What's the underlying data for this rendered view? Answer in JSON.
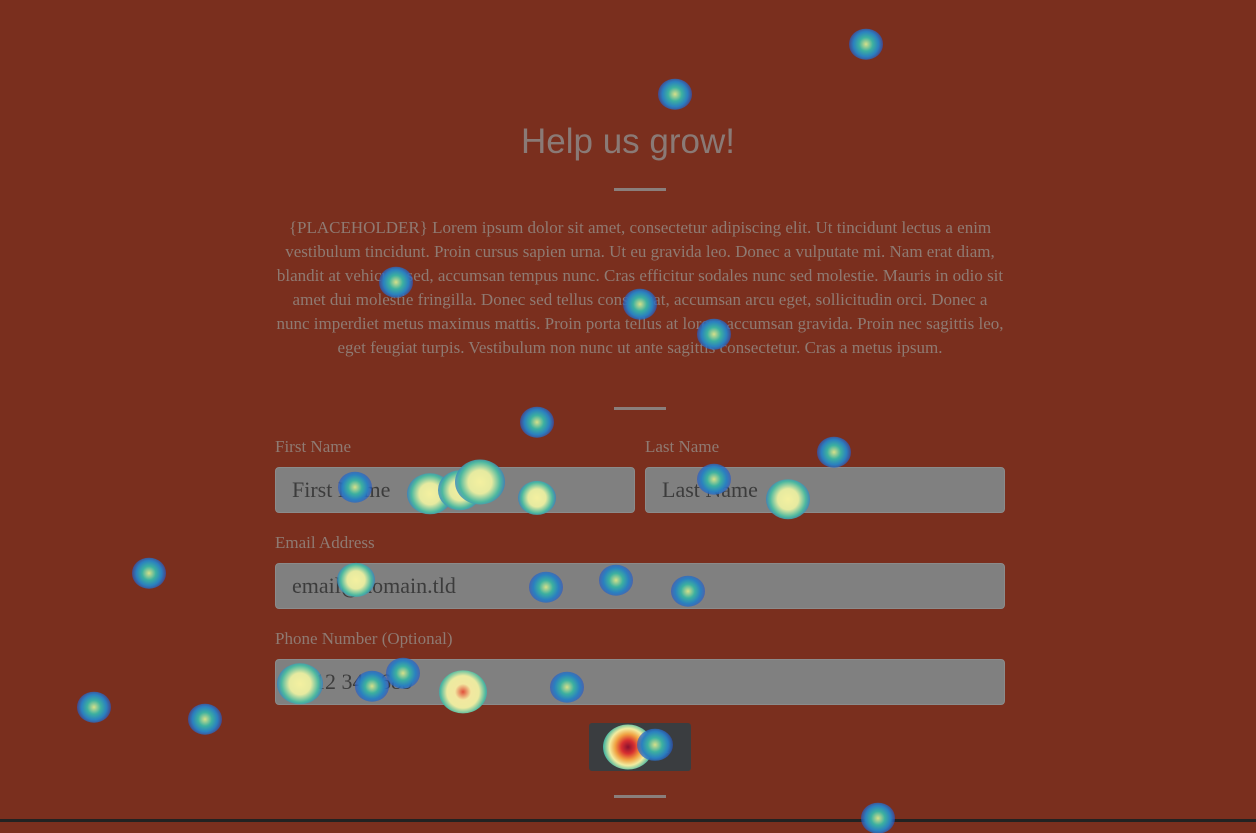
{
  "header": {
    "title": "Help us grow!"
  },
  "intro": {
    "text": "{PLACEHOLDER} Lorem ipsum dolor sit amet, consectetur adipiscing elit. Ut tincidunt lectus a enim vestibulum tincidunt. Proin cursus sapien urna. Ut eu gravida leo. Donec a vulputate mi. Nam erat diam, blandit at vehicula sed, accumsan tempus nunc. Cras efficitur sodales nunc sed molestie. Mauris in odio sit amet dui molestie fringilla. Donec sed tellus consequat, accumsan arcu eget, sollicitudin orci. Donec a nunc imperdiet metus maximus mattis. Proin porta tellus at lorem accumsan gravida. Proin nec sagittis leo, eget feugiat turpis. Vestibulum non nunc ut ante sagittis consectetur. Cras a metus ipsum."
  },
  "form": {
    "first_name": {
      "label": "First Name",
      "placeholder": "First Name"
    },
    "last_name": {
      "label": "Last Name",
      "placeholder": "Last Name"
    },
    "email": {
      "label": "Email Address",
      "placeholder": "email@domain.tld"
    },
    "phone": {
      "label": "Phone Number (Optional)",
      "placeholder": "0712 345 689"
    },
    "submit_label": "Submit"
  },
  "colors": {
    "background": "#7a2f1e",
    "input": "#808080",
    "button": "#3a3d40"
  },
  "overlay": {
    "type": "click-heatmap"
  }
}
